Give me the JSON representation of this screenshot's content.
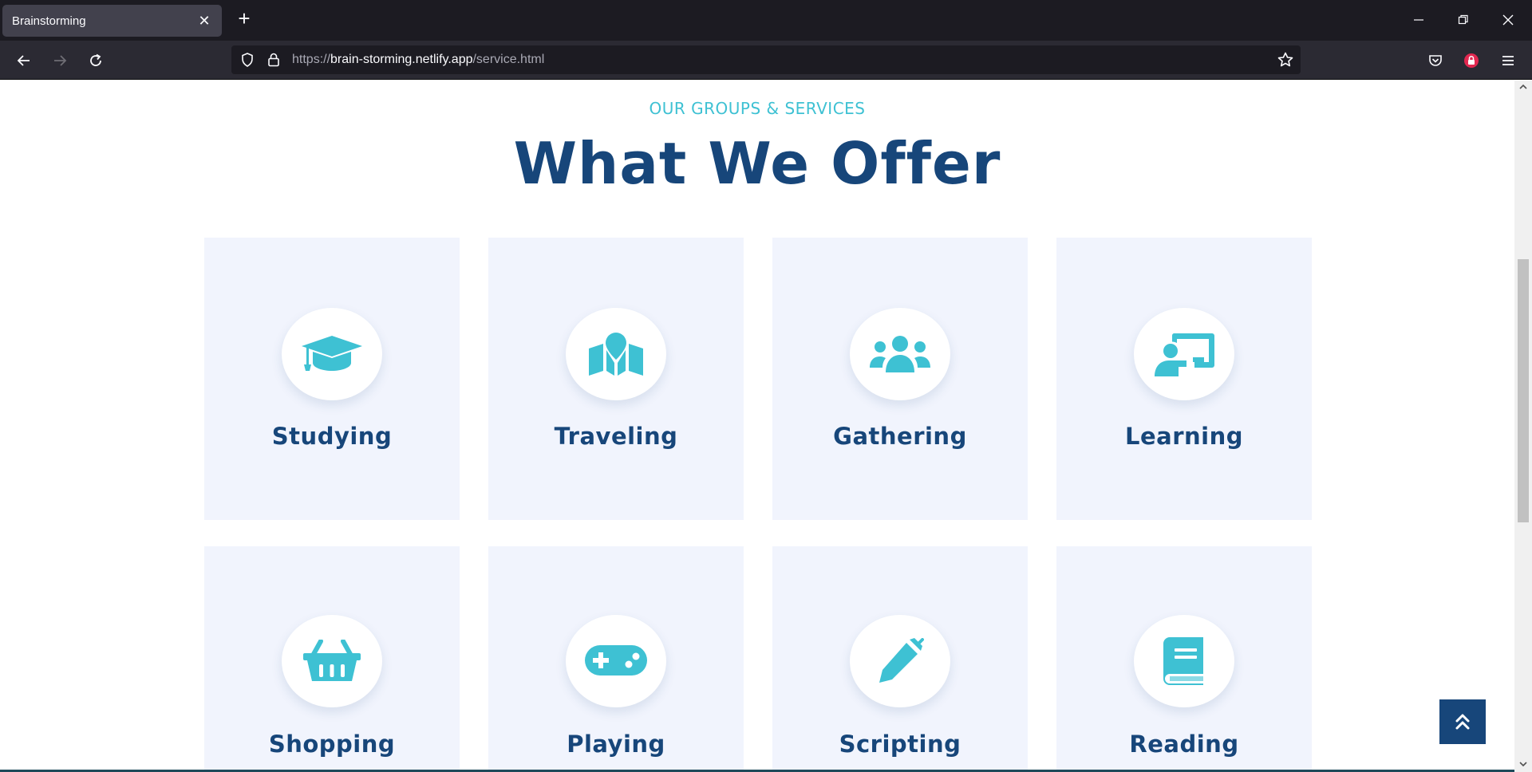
{
  "browser": {
    "tab_title": "Brainstorming",
    "url_scheme": "https://",
    "url_host": "brain-storming.netlify.app",
    "url_path": "/service.html"
  },
  "page": {
    "kicker": "OUR GROUPS & SERVICES",
    "heading": "What We Offer",
    "services": [
      {
        "label": "Studying",
        "icon": "graduation-cap-icon"
      },
      {
        "label": "Traveling",
        "icon": "map-location-icon"
      },
      {
        "label": "Gathering",
        "icon": "users-icon"
      },
      {
        "label": "Learning",
        "icon": "chalkboard-teacher-icon"
      },
      {
        "label": "Shopping",
        "icon": "shopping-basket-icon"
      },
      {
        "label": "Playing",
        "icon": "gamepad-icon"
      },
      {
        "label": "Scripting",
        "icon": "pen-icon"
      },
      {
        "label": "Reading",
        "icon": "book-icon"
      }
    ]
  },
  "colors": {
    "accent": "#3ec1d3",
    "heading": "#17467a",
    "card_bg": "#f1f4fd"
  }
}
